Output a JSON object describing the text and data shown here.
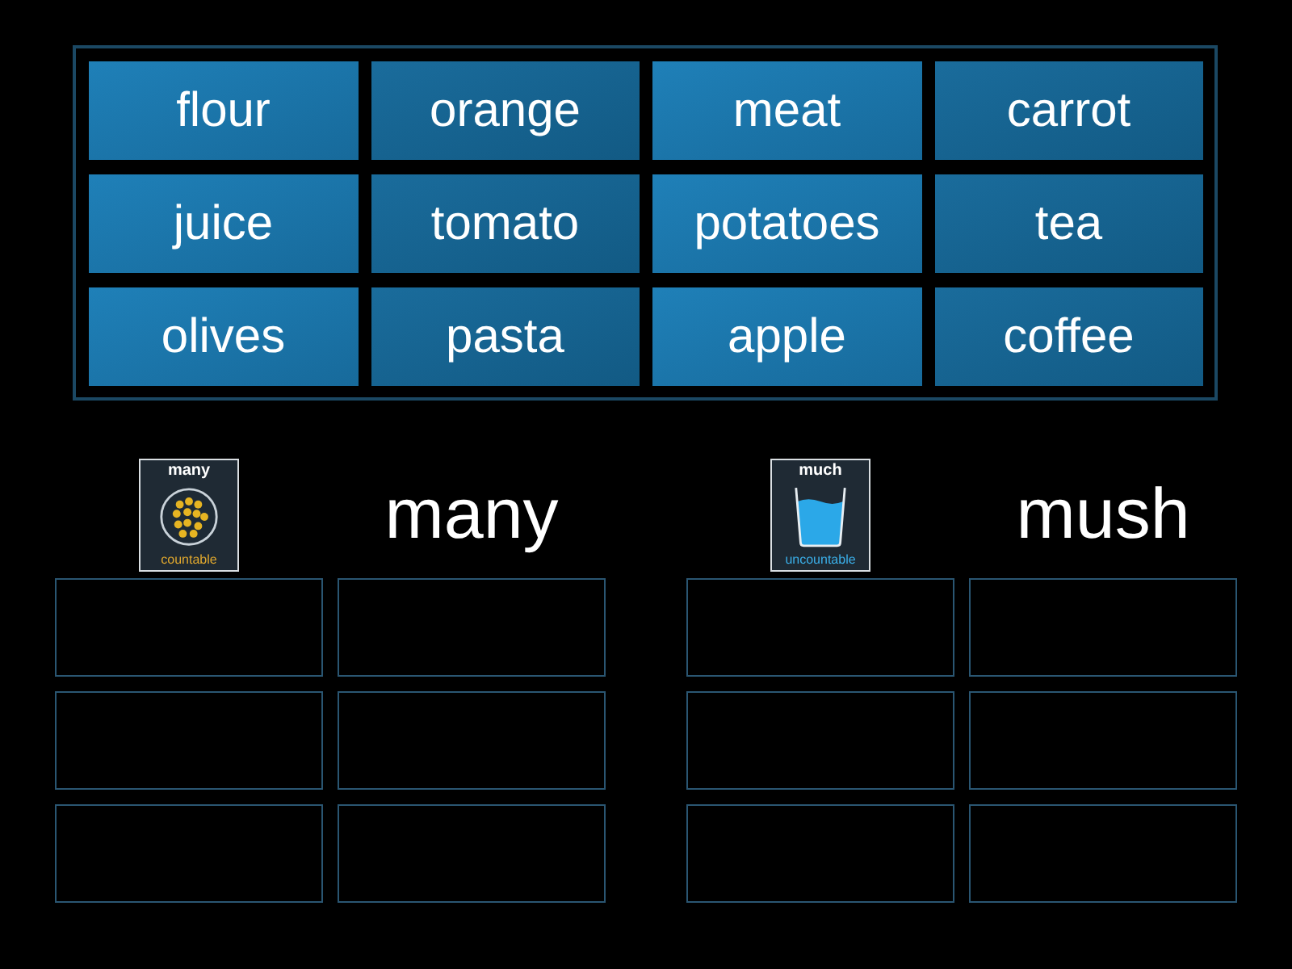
{
  "tiles": [
    "flour",
    "orange",
    "meat",
    "carrot",
    "juice",
    "tomato",
    "potatoes",
    "tea",
    "olives",
    "pasta",
    "apple",
    "coffee"
  ],
  "groups": [
    {
      "picture": {
        "kind": "dots",
        "title": "many",
        "caption": "countable"
      },
      "heading": "many",
      "slots": [
        {
          "kind": "empty"
        },
        {
          "kind": "empty"
        },
        {
          "kind": "empty"
        },
        {
          "kind": "empty"
        },
        {
          "kind": "empty"
        },
        {
          "kind": "empty"
        }
      ]
    },
    {
      "picture": {
        "kind": "glass",
        "title": "much",
        "caption": "uncountable"
      },
      "heading": "mush",
      "slots": [
        {
          "kind": "empty"
        },
        {
          "kind": "empty"
        },
        {
          "kind": "empty"
        },
        {
          "kind": "empty"
        },
        {
          "kind": "empty"
        },
        {
          "kind": "empty"
        }
      ]
    }
  ]
}
